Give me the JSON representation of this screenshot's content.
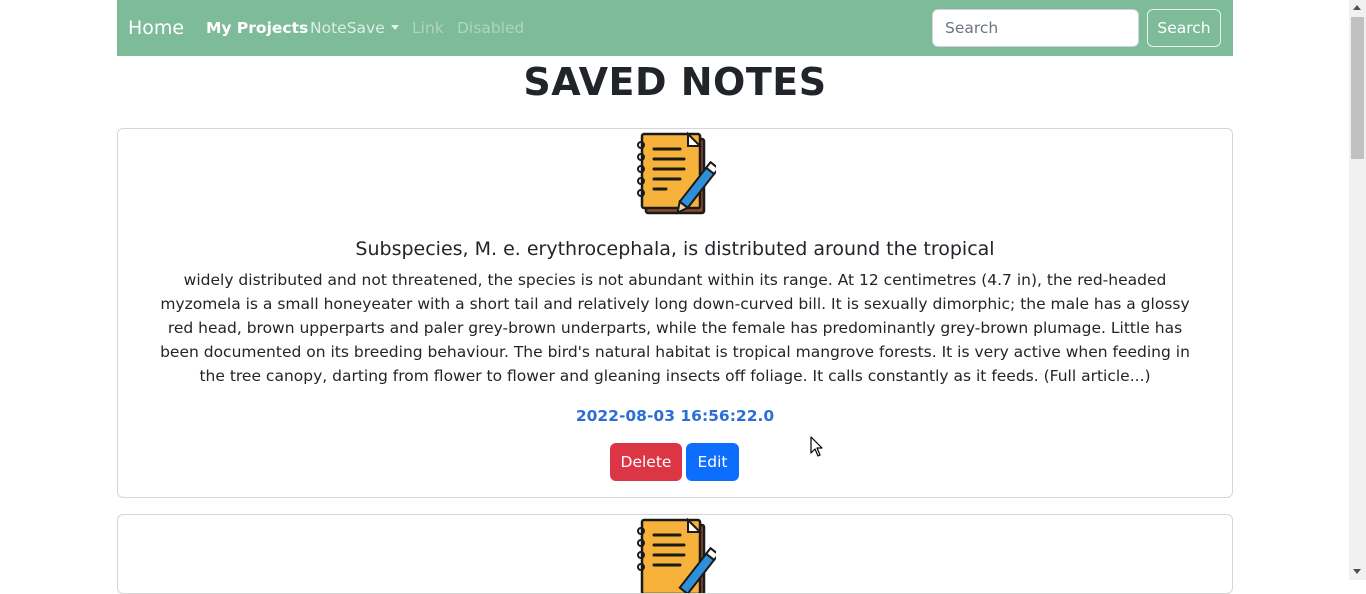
{
  "navbar": {
    "brand": "Home",
    "links": [
      {
        "label": "My Projects",
        "state": "active"
      },
      {
        "label": "NoteSave",
        "state": "dropdown"
      },
      {
        "label": "Link",
        "state": "disabled"
      },
      {
        "label": "Disabled",
        "state": "disabled"
      }
    ],
    "search_placeholder": "Search",
    "search_button": "Search",
    "background_color": "#7dbb99"
  },
  "page_title": "SAVED NOTES",
  "notes": [
    {
      "icon": "notebook-pencil-icon",
      "title": "Subspecies, M. e. erythrocephala, is distributed around the tropical",
      "body": "widely distributed and not threatened, the species is not abundant within its range. At 12 centimetres (4.7 in), the red-headed myzomela is a small honeyeater with a short tail and relatively long down-curved bill. It is sexually dimorphic; the male has a glossy red head, brown upperparts and paler grey-brown underparts, while the female has predominantly grey-brown plumage. Little has been documented on its breeding behaviour. The bird's natural habitat is tropical mangrove forests. It is very active when feeding in the tree canopy, darting from flower to flower and gleaning insects off foliage. It calls constantly as it feeds. (Full article...)",
      "date": "2022-08-03 16:56:22.0",
      "delete_label": "Delete",
      "edit_label": "Edit"
    },
    {
      "icon": "notebook-pencil-icon"
    }
  ],
  "colors": {
    "delete": "#dc3545",
    "edit": "#0d6efd",
    "date": "#2b6fd6"
  }
}
